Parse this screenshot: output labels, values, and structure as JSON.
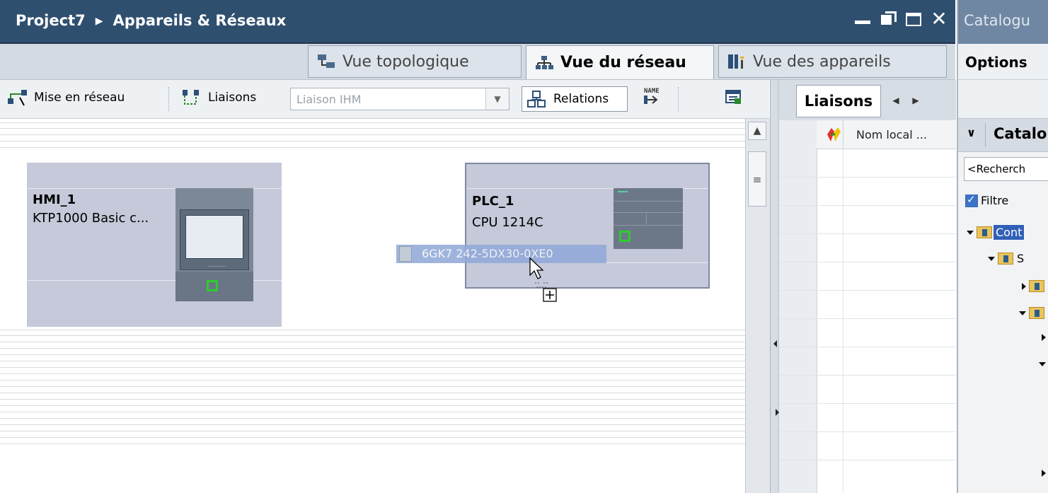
{
  "titlebar": {
    "project": "Project7",
    "separator": "▶",
    "section": "Appareils & Réseaux",
    "close": "✕"
  },
  "tabs": {
    "topology": "Vue topologique",
    "network": "Vue du réseau",
    "devices": "Vue des appareils"
  },
  "toolbar": {
    "networking": "Mise en réseau",
    "connections": "Liaisons",
    "connection_type": "Liaison IHM",
    "relations": "Relations"
  },
  "devices": [
    {
      "name": "HMI_1",
      "type": "KTP1000 Basic c..."
    },
    {
      "name": "PLC_1",
      "type": "CPU 1214C"
    }
  ],
  "drag_item": {
    "order_number": "6GK7 242-5DX30-0XE0"
  },
  "connections_panel": {
    "tab": "Liaisons",
    "column_local_name": "Nom local ..."
  },
  "catalog": {
    "title": "Catalogu",
    "options": "Options",
    "section": "Catalo",
    "search_placeholder": "<Recherch",
    "filter_label": "Filtre",
    "tree": [
      {
        "label": "Cont"
      },
      {
        "label": "S"
      }
    ]
  },
  "colors": {
    "titlebar": "#2f4f6f",
    "device_fill": "#c5c9d9",
    "status_green": "#2ecc2e",
    "selection": "#8fa7d8"
  }
}
